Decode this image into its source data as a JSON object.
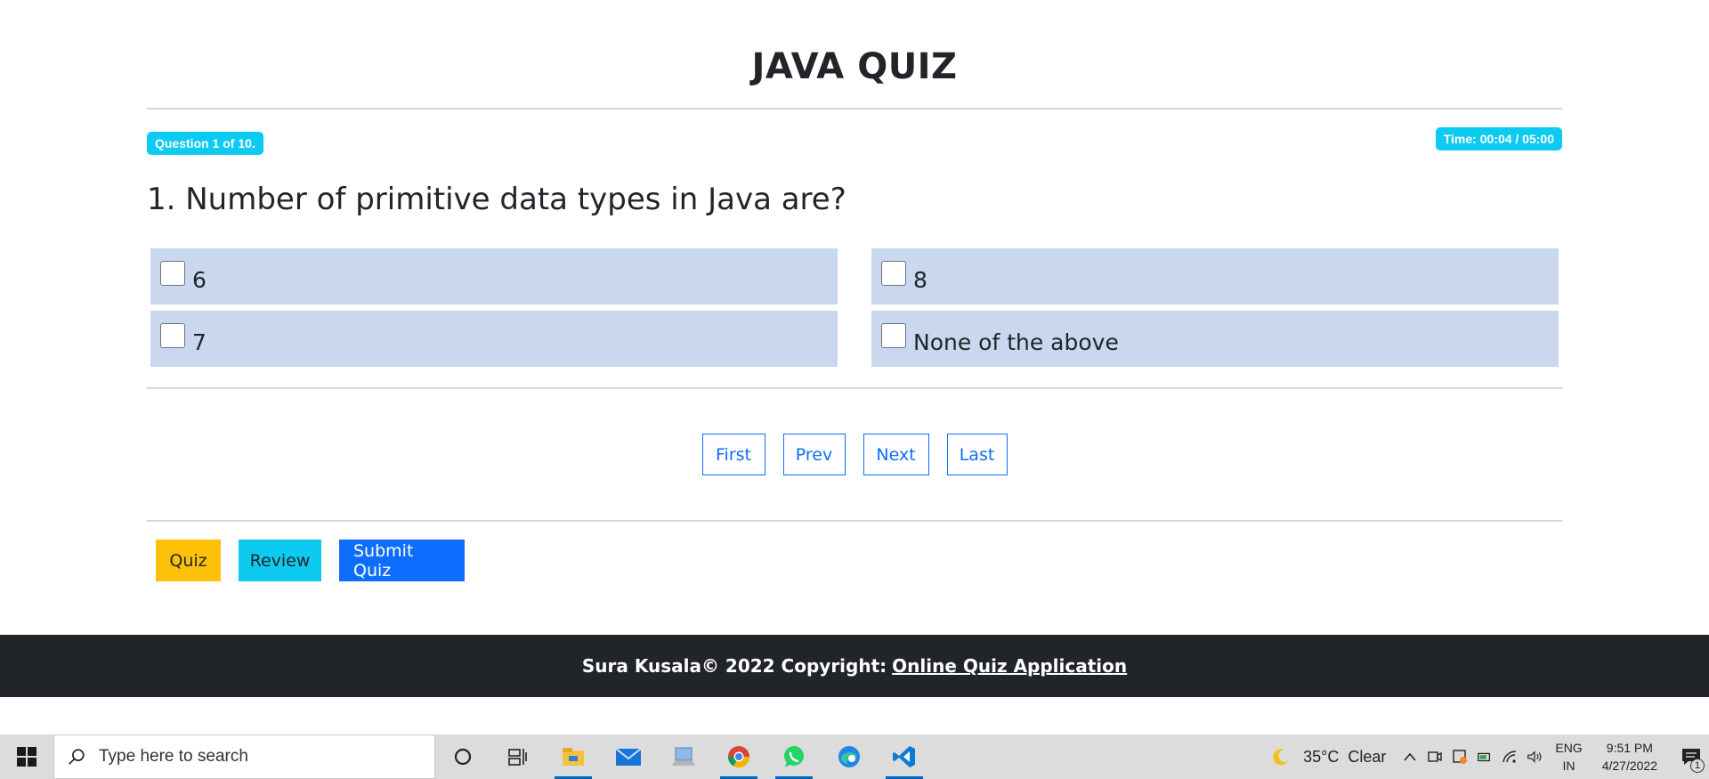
{
  "header": {
    "title": "JAVA QUIZ"
  },
  "status": {
    "question_counter": "Question 1 of 10.",
    "timer": "Time: 00:04 / 05:00"
  },
  "question": {
    "text": "1. Number of primitive data types in Java are?",
    "options": [
      {
        "label": "6",
        "checked": false
      },
      {
        "label": "8",
        "checked": false
      },
      {
        "label": "7",
        "checked": false
      },
      {
        "label": "None of the above",
        "checked": false
      }
    ]
  },
  "pager": {
    "first": "First",
    "prev": "Prev",
    "next": "Next",
    "last": "Last"
  },
  "actions": {
    "quiz": "Quiz",
    "review": "Review",
    "submit": "Submit Quiz"
  },
  "footer": {
    "text": "Sura Kusala© 2022 Copyright:",
    "link": "Online Quiz Application"
  },
  "taskbar": {
    "search_placeholder": "Type here to search",
    "apps": [
      "cortana-icon",
      "task-view-icon",
      "file-explorer-icon",
      "mail-icon",
      "laptop-app-icon",
      "chrome-icon",
      "whatsapp-icon",
      "edge-icon",
      "vscode-icon"
    ],
    "weather_temp": "35°C",
    "weather_condition": "Clear",
    "lang_line1": "ENG",
    "lang_line2": "IN",
    "time": "9:51 PM",
    "date": "4/27/2022",
    "notification_count": "1"
  },
  "colors": {
    "accent": "#0d6efd",
    "info": "#0dcaf0",
    "warning": "#ffc107",
    "option_bg": "#c9d8ee",
    "footer_bg": "#212529"
  }
}
